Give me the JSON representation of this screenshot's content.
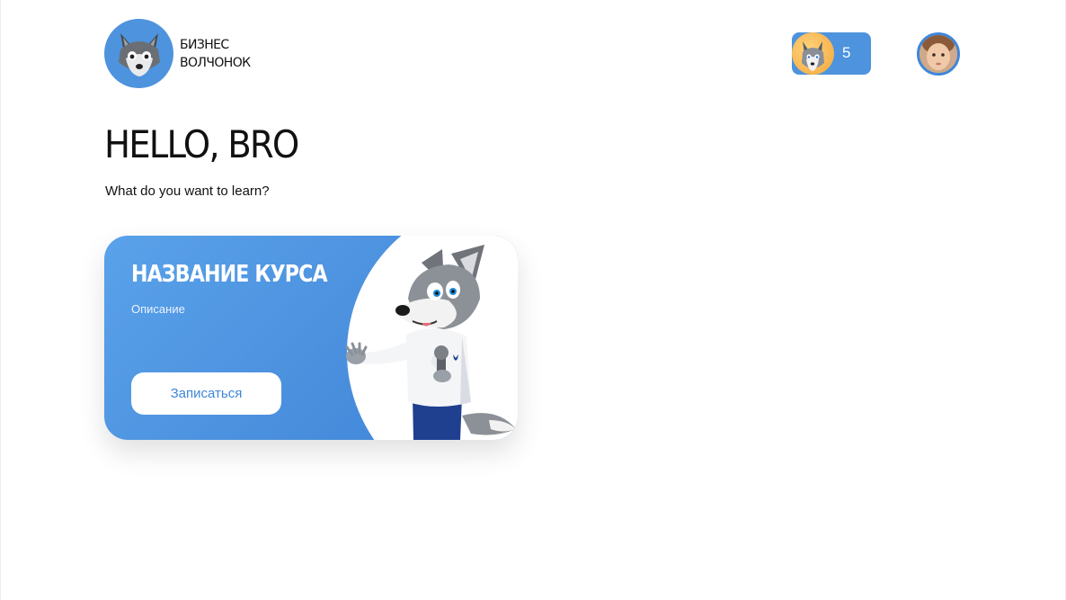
{
  "header": {
    "logo": {
      "icon": "wolf-logo-icon",
      "line1": "Бизнес",
      "line2": "Волчонок"
    },
    "points": {
      "icon": "wolf-avatar-icon",
      "value": "5"
    },
    "user": {
      "icon": "user-avatar"
    }
  },
  "main": {
    "greeting": "HELLO, BRO",
    "subtitle": "What do you want to learn?"
  },
  "course": {
    "title": "Название курса",
    "description": "Описание",
    "button_label": "Записаться",
    "mascot": "wolf-mascot-illustration"
  },
  "colors": {
    "accent": "#4d93de",
    "text": "#111111",
    "background": "#ffffff"
  }
}
